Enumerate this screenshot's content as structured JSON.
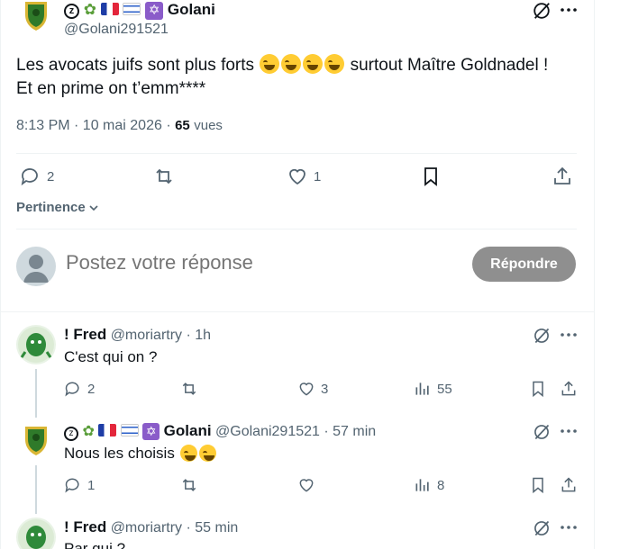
{
  "main_tweet": {
    "display_name": "Golani",
    "handle": "@Golani291521",
    "text_line1_a": "Les avocats juifs sont plus forts",
    "text_line1_b": "surtout Maître Goldnadel !",
    "text_line2": "Et en prime on t’emm****",
    "time": "8:13 PM · 10 mai 2026 ·",
    "views_count": "65",
    "views_label": "vues",
    "replies": "2",
    "likes": "1"
  },
  "sort": {
    "label": "Pertinence"
  },
  "composer": {
    "placeholder": "Postez votre réponse",
    "button": "Répondre"
  },
  "replies": [
    {
      "display_name": "! Fred",
      "handle": "@moriartry",
      "time": "· 1h",
      "text": "C'est qui on ?",
      "reply_count": "2",
      "like_count": "3",
      "views": "55"
    },
    {
      "display_name": "Golani",
      "handle": "@Golani291521",
      "time": "· 57 min",
      "text": "Nous les choisis",
      "reply_count": "1",
      "like_count": "",
      "views": "8"
    },
    {
      "display_name": "! Fred",
      "handle": "@moriartry",
      "time": "· 55 min",
      "text": "Par qui ?"
    }
  ],
  "colors": {
    "text": "#0f1419",
    "muted": "#536471",
    "divider": "#eff3f4",
    "button_disabled": "#8f8f8f"
  },
  "icons": [
    "grok-icon",
    "more-icon",
    "reply-icon",
    "repost-icon",
    "like-icon",
    "bookmark-icon",
    "share-icon",
    "views-icon"
  ]
}
